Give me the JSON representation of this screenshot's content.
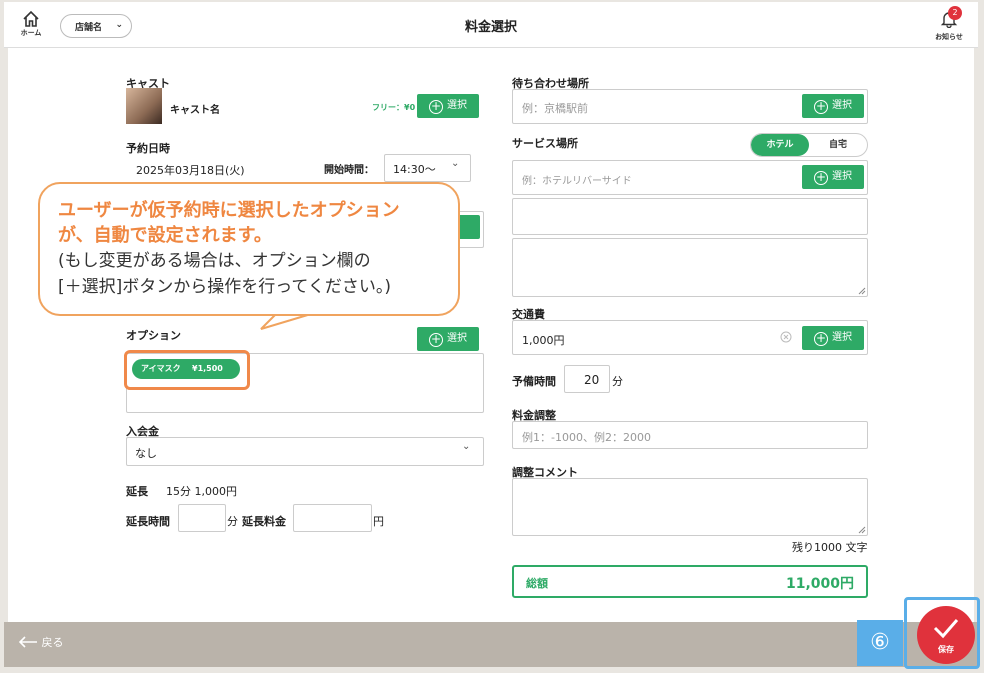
{
  "header": {
    "home_label": "ホーム",
    "store_select": "店舗名",
    "title": "料金選択",
    "notification_label": "お知らせ",
    "notification_count": "2"
  },
  "left": {
    "cast_label": "キャスト",
    "cast_name": "キャスト名",
    "cast_free": "フリー：¥0",
    "select_label": "選択",
    "reserve_label": "予約日時",
    "reserve_date": "2025年03月18日(火)",
    "start_time_label": "開始時間：",
    "start_time_value": "14:30〜",
    "option_label": "オプション",
    "option_name": "アイマスク",
    "option_price": "¥1,500",
    "membership_label": "入会金",
    "membership_value": "なし",
    "extension_label": "延長",
    "extension_value": "15分 1,000円",
    "extension_time_label": "延長時間",
    "minutes_unit": "分",
    "extension_fee_label": "延長料金",
    "yen_unit": "円"
  },
  "right": {
    "meeting_label": "待ち合わせ場所",
    "meeting_placeholder": "例：京橋駅前",
    "service_label": "サービス場所",
    "toggle_hotel": "ホテル",
    "toggle_home": "自宅",
    "service_placeholder": "例：ホテルリバーサイド",
    "transport_label": "交通費",
    "transport_value": "1,000円",
    "spare_time_label": "予備時間",
    "spare_time_value": "20",
    "spare_time_unit": "分",
    "adjust_label": "料金調整",
    "adjust_placeholder": "例1：-1000、例2：2000",
    "comment_label": "調整コメント",
    "remaining": "残り1000 文字",
    "total_label": "総額",
    "total_value": "11,000円"
  },
  "callout": {
    "line1": "ユーザーが仮予約時に選択したオプション",
    "line2": "が、自動で設定されます。",
    "line3": "(もし変更がある場合は、オプション欄の",
    "line4": "[＋選択]ボタンから操作を行ってください。)"
  },
  "footer": {
    "back_label": "戻る",
    "save_label": "保存",
    "step_number": "⑥"
  },
  "colors": {
    "accent_green": "#2eaa66",
    "save_red": "#e0323c",
    "callout_orange": "#ef8741",
    "step_blue": "#5aaee8"
  }
}
